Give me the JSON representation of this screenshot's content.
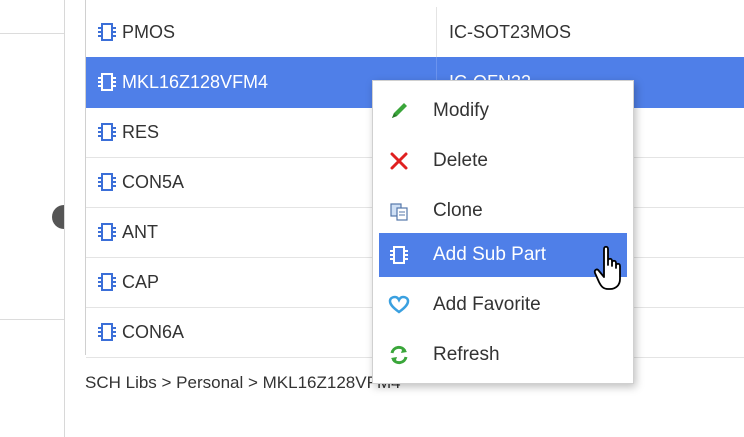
{
  "parts_table": {
    "rows": [
      {
        "name": "PMOS",
        "footprint": "IC-SOT23MOS",
        "selected": false
      },
      {
        "name": "MKL16Z128VFM4",
        "footprint": "IC-QFN32",
        "selected": true
      },
      {
        "name": "RES",
        "footprint": "",
        "selected": false
      },
      {
        "name": "CON5A",
        "footprint": "",
        "selected": false
      },
      {
        "name": "ANT",
        "footprint": "",
        "selected": false
      },
      {
        "name": "CAP",
        "footprint": "",
        "selected": false
      },
      {
        "name": "CON6A",
        "footprint": "",
        "selected": false
      }
    ]
  },
  "breadcrumb": {
    "text": "SCH Libs > Personal > MKL16Z128VFM4"
  },
  "context_menu": {
    "items": [
      {
        "label": "Modify",
        "icon": "pencil-icon"
      },
      {
        "label": "Delete",
        "icon": "delete-x-icon"
      },
      {
        "label": "Clone",
        "icon": "clone-icon"
      },
      {
        "label": "Add Sub Part",
        "icon": "sub-part-icon"
      },
      {
        "label": "Add Favorite",
        "icon": "heart-icon"
      },
      {
        "label": "Refresh",
        "icon": "refresh-icon"
      }
    ],
    "hovered_item": "Add Sub Part"
  },
  "colors": {
    "selection": "#4f7fe8",
    "chip_icon": "#3b6fd8",
    "pencil": "#3aa63a",
    "delete": "#e02020",
    "heart": "#3aa0e0",
    "refresh": "#3aa63a"
  }
}
